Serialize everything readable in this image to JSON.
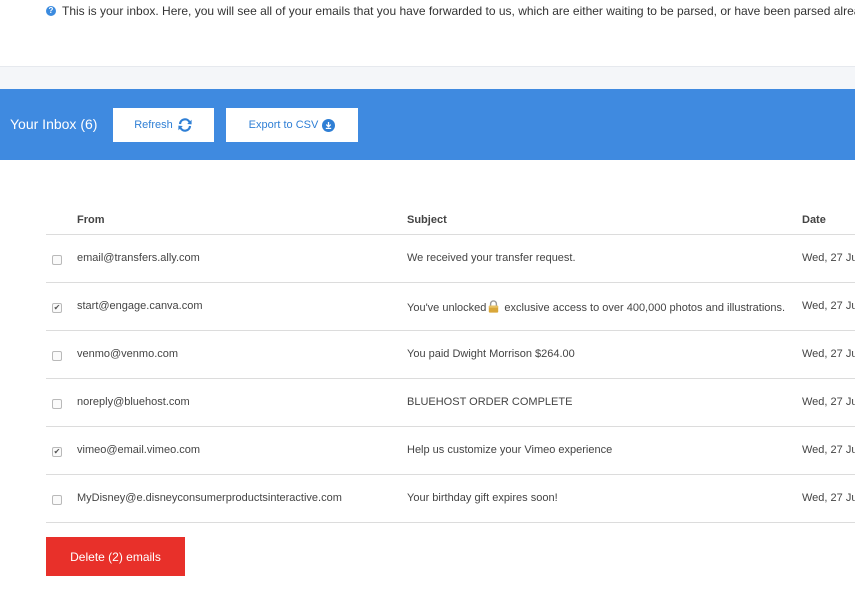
{
  "info": {
    "icon": "question-icon",
    "text": "This is your inbox. Here, you will see all of your emails that you have forwarded to us, which are either waiting to be parsed, or have been parsed already. From her"
  },
  "header": {
    "title": "Your Inbox (6)",
    "refresh_label": "Refresh",
    "export_label": "Export to CSV",
    "accent_color": "#3f8ae0"
  },
  "table": {
    "columns": {
      "from": "From",
      "subject": "Subject",
      "date": "Date"
    },
    "rows": [
      {
        "from": "email@transfers.ally.com",
        "subject": "We received your transfer request.",
        "subject_after": "",
        "date": "Wed, 27 Ju",
        "checked": false
      },
      {
        "from": "start@engage.canva.com",
        "subject": "You've unlocked",
        "subject_after": " exclusive access to over 400,000 photos and illustrations.",
        "date": "Wed, 27 Ju",
        "checked": true
      },
      {
        "from": "venmo@venmo.com",
        "subject": "You paid Dwight Morrison $264.00",
        "subject_after": "",
        "date": "Wed, 27 Ju",
        "checked": false
      },
      {
        "from": "noreply@bluehost.com",
        "subject": "BLUEHOST ORDER COMPLETE",
        "subject_after": "",
        "date": "Wed, 27 Ju",
        "checked": false
      },
      {
        "from": "vimeo@email.vimeo.com",
        "subject": "Help us customize your Vimeo experience",
        "subject_after": "",
        "date": "Wed, 27 Ju",
        "checked": true
      },
      {
        "from": "MyDisney@e.disneyconsumerproductsinteractive.com",
        "subject": "Your birthday gift expires soon!",
        "subject_after": "",
        "date": "Wed, 27 Ju",
        "checked": false
      }
    ]
  },
  "delete_button": {
    "label": "Delete (2) emails",
    "color": "#e8302a"
  }
}
